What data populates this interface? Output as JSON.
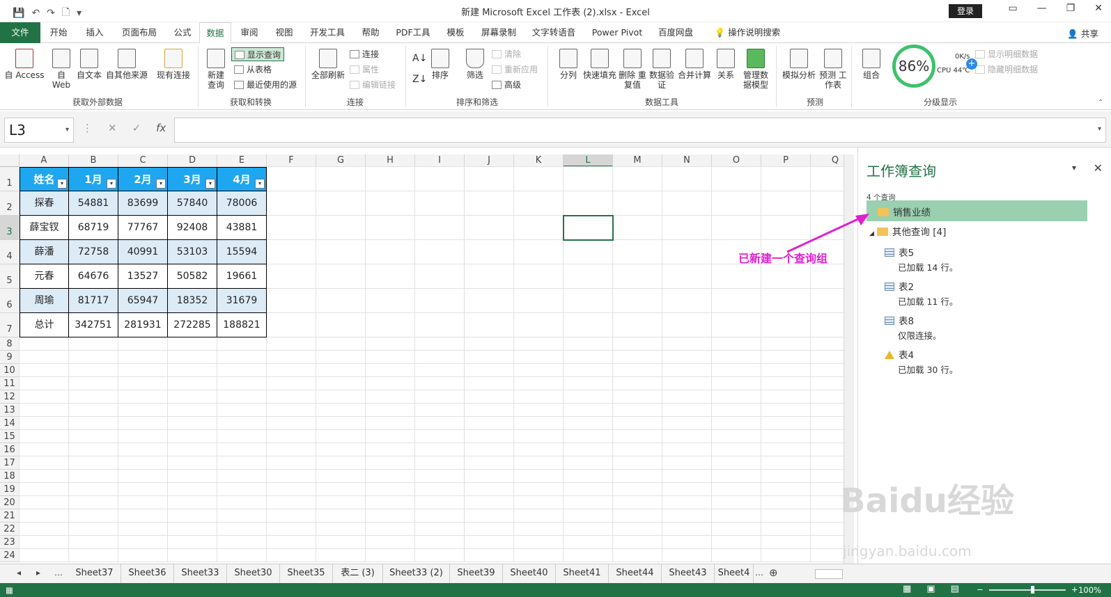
{
  "window": {
    "title": "新建 Microsoft Excel 工作表 (2).xlsx  -  Excel",
    "login": "登录"
  },
  "tabs": [
    "文件",
    "开始",
    "插入",
    "页面布局",
    "公式",
    "数据",
    "审阅",
    "视图",
    "开发工具",
    "帮助",
    "PDF工具",
    "模板",
    "屏幕录制",
    "文字转语音",
    "Power Pivot",
    "百度网盘",
    "操作说明搜索"
  ],
  "share": "共享",
  "ribbon": {
    "get_external": {
      "label": "获取外部数据",
      "buttons": [
        "自 Access",
        "自 Web",
        "自文本",
        "自其他来源",
        "现有连接"
      ]
    },
    "get_transform": {
      "label": "获取和转换",
      "new_query": "新建 查询",
      "show_query": "显示查询",
      "from_table": "从表格",
      "recent": "最近使用的源"
    },
    "connections": {
      "label": "连接",
      "refresh_all": "全部刷新",
      "conn": "连接",
      "props": "属性",
      "edit_links": "编辑链接"
    },
    "sort_filter": {
      "label": "排序和筛选",
      "sort": "排序",
      "filter": "筛选",
      "clear": "清除",
      "reapply": "重新应用",
      "advanced": "高级"
    },
    "data_tools": {
      "label": "数据工具",
      "buttons": [
        "分列",
        "快速填充",
        "删除 重复值",
        "数据验 证",
        "合并计算",
        "关系",
        "管理数 据模型"
      ]
    },
    "forecast": {
      "label": "预测",
      "buttons": [
        "模拟分析",
        "预测 工作表"
      ]
    },
    "outline": {
      "label": "分级显示",
      "group": "组合",
      "show_detail": "显示明细数据",
      "hide_detail": "隐藏明细数据"
    },
    "monitor": {
      "percent": "86%",
      "net": "0K/s",
      "cpu": "CPU 44℃"
    }
  },
  "formula_bar": {
    "name_box": "L3",
    "formula": ""
  },
  "columns": [
    "A",
    "B",
    "C",
    "D",
    "E",
    "F",
    "G",
    "H",
    "I",
    "J",
    "K",
    "L",
    "M",
    "N",
    "O",
    "P",
    "Q"
  ],
  "rows": [
    "1",
    "2",
    "3",
    "4",
    "5",
    "6",
    "7",
    "8",
    "9",
    "10",
    "11",
    "12",
    "13",
    "14",
    "15",
    "16",
    "17",
    "18",
    "19",
    "20",
    "21",
    "22",
    "23",
    "24"
  ],
  "table": {
    "headers": [
      "姓名",
      "1月",
      "2月",
      "3月",
      "4月"
    ],
    "rows": [
      [
        "探春",
        "54881",
        "83699",
        "57840",
        "78006"
      ],
      [
        "薛宝钗",
        "68719",
        "77767",
        "92408",
        "43881"
      ],
      [
        "薛潘",
        "72758",
        "40991",
        "53103",
        "15594"
      ],
      [
        "元春",
        "64676",
        "13527",
        "50582",
        "19661"
      ],
      [
        "周瑜",
        "81717",
        "65947",
        "18352",
        "31679"
      ],
      [
        "总计",
        "342751",
        "281931",
        "272285",
        "188821"
      ]
    ]
  },
  "panel": {
    "title": "工作簿查询",
    "count": "4 个查询",
    "group_selected": "销售业绩",
    "group_other": "其他查询 [4]",
    "queries": [
      {
        "name": "表5",
        "status": "已加载 14 行。",
        "icon": "table-icon"
      },
      {
        "name": "表2",
        "status": "已加载 11 行。",
        "icon": "table-icon"
      },
      {
        "name": "表8",
        "status": "仅限连接。",
        "icon": "table-icon"
      },
      {
        "name": "表4",
        "status": "已加载 30 行。",
        "icon": "warning-icon"
      }
    ]
  },
  "annotation": "已新建一个查询组",
  "sheets": [
    "Sheet37",
    "Sheet36",
    "Sheet33",
    "Sheet30",
    "Sheet35",
    "表二 (3)",
    "Sheet33 (2)",
    "Sheet39",
    "Sheet40",
    "Sheet41",
    "Sheet44",
    "Sheet43",
    "Sheet4"
  ],
  "status": {
    "zoom": "100%"
  },
  "watermark": {
    "logo": "Baidu经验",
    "url": "jingyan.baidu.com"
  },
  "colors": {
    "excel_green": "#217346",
    "header_blue": "#1fa6f0",
    "band_blue": "#ddebf7",
    "annotation": "#e020d0"
  }
}
